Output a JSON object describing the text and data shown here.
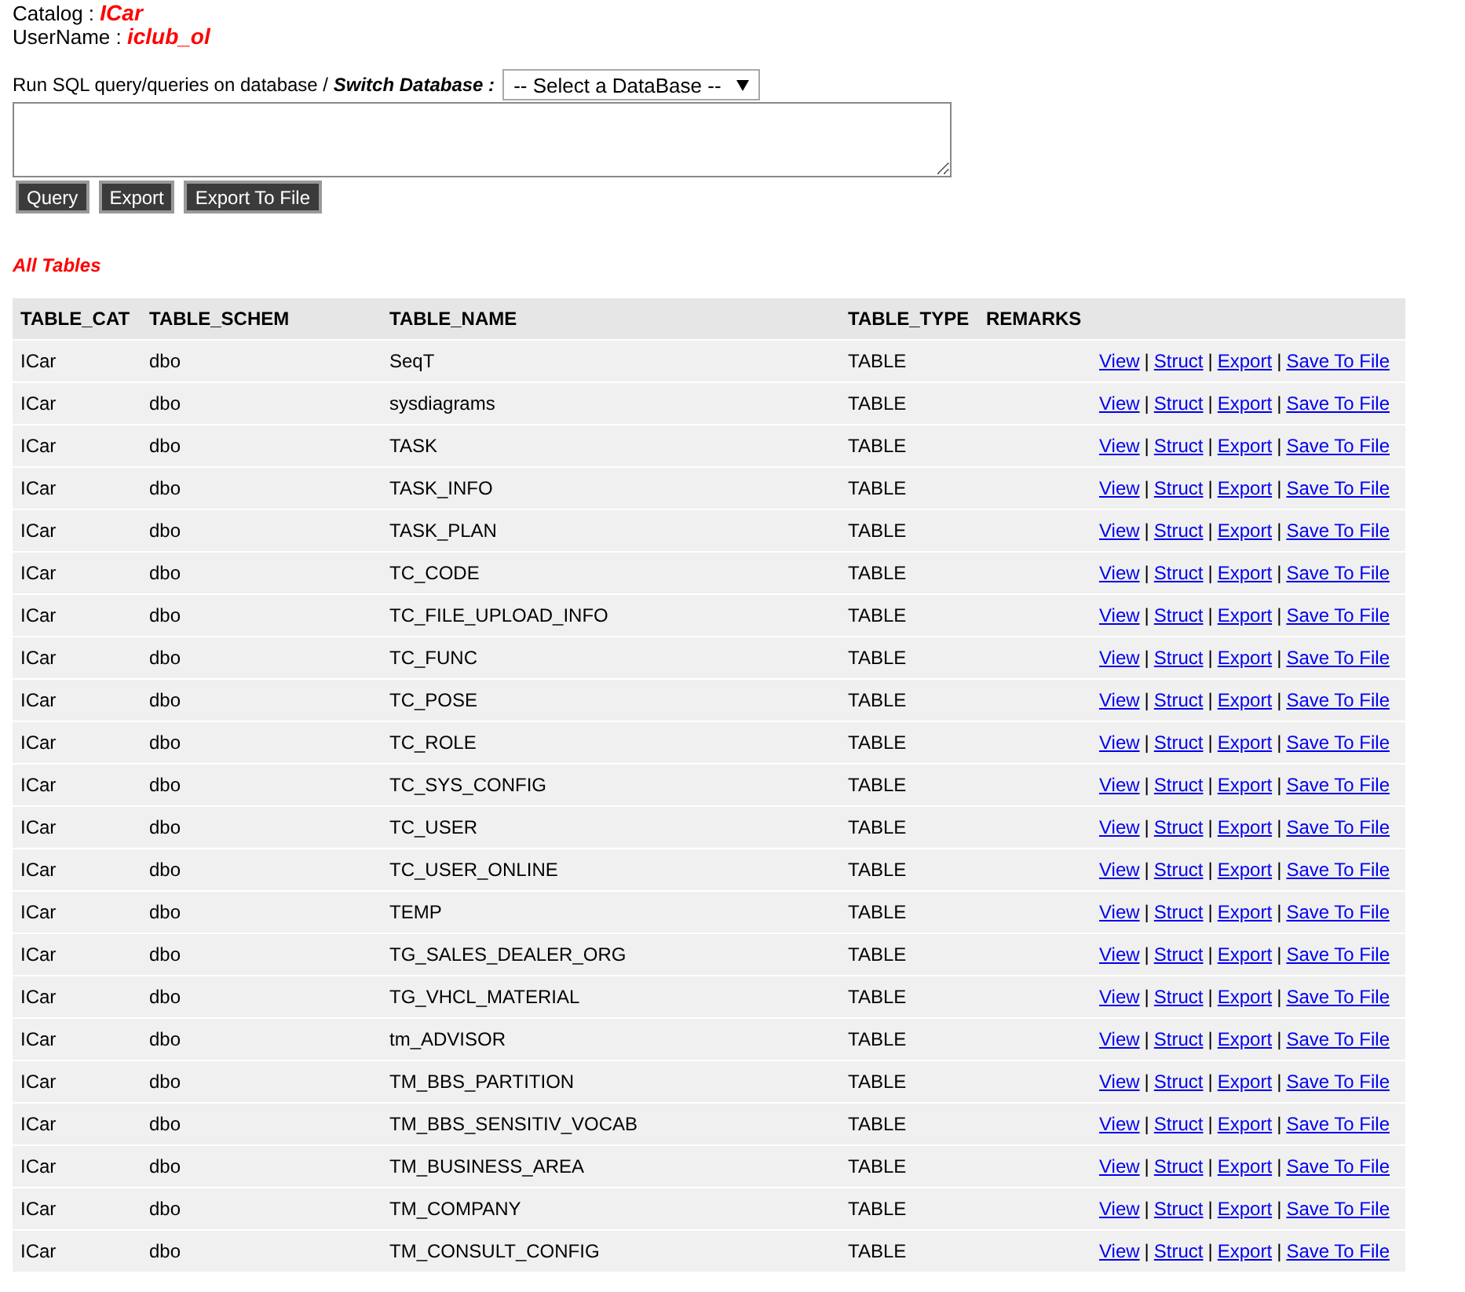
{
  "info": [
    {
      "label": "Catalog : ",
      "value": "ICar"
    },
    {
      "label": "UserName : ",
      "value": "iclub_ol"
    }
  ],
  "query": {
    "prompt": "Run SQL query/queries on database / ",
    "switch_label": "Switch Database :",
    "select": "-- Select a DataBase --",
    "buttons": [
      "Query",
      "Export",
      "Export To File"
    ]
  },
  "section_title": "All Tables",
  "table": {
    "columns": [
      "TABLE_CAT",
      "TABLE_SCHEM",
      "TABLE_NAME",
      "TABLE_TYPE",
      "REMARKS"
    ],
    "rows": [
      {
        "cells": [
          "ICar",
          "dbo",
          "SeqT",
          "TABLE"
        ],
        "actions": [
          {
            "label": "View"
          },
          {
            "separator": "|",
            "label": "Struct"
          },
          {
            "separator": "|",
            "label": "Export"
          },
          {
            "separator": "|",
            "label": "Save To File"
          }
        ]
      },
      {
        "cells": [
          "ICar",
          "dbo",
          "sysdiagrams",
          "TABLE"
        ],
        "actions": [
          {
            "label": "View"
          },
          {
            "separator": "|",
            "label": "Struct"
          },
          {
            "separator": "|",
            "label": "Export"
          },
          {
            "separator": "|",
            "label": "Save To File"
          }
        ]
      },
      {
        "cells": [
          "ICar",
          "dbo",
          "TASK",
          "TABLE"
        ],
        "actions": [
          {
            "label": "View"
          },
          {
            "separator": "|",
            "label": "Struct"
          },
          {
            "separator": "|",
            "label": "Export"
          },
          {
            "separator": "|",
            "label": "Save To File"
          }
        ]
      },
      {
        "cells": [
          "ICar",
          "dbo",
          "TASK_INFO",
          "TABLE"
        ],
        "actions": [
          {
            "label": "View"
          },
          {
            "separator": "|",
            "label": "Struct"
          },
          {
            "separator": "|",
            "label": "Export"
          },
          {
            "separator": "|",
            "label": "Save To File"
          }
        ]
      },
      {
        "cells": [
          "ICar",
          "dbo",
          "TASK_PLAN",
          "TABLE"
        ],
        "actions": [
          {
            "label": "View"
          },
          {
            "separator": "|",
            "label": "Struct"
          },
          {
            "separator": "|",
            "label": "Export"
          },
          {
            "separator": "|",
            "label": "Save To File"
          }
        ]
      },
      {
        "cells": [
          "ICar",
          "dbo",
          "TC_CODE",
          "TABLE"
        ],
        "actions": [
          {
            "label": "View"
          },
          {
            "separator": "|",
            "label": "Struct"
          },
          {
            "separator": "|",
            "label": "Export"
          },
          {
            "separator": "|",
            "label": "Save To File"
          }
        ]
      },
      {
        "cells": [
          "ICar",
          "dbo",
          "TC_FILE_UPLOAD_INFO",
          "TABLE"
        ],
        "actions": [
          {
            "label": "View"
          },
          {
            "separator": "|",
            "label": "Struct"
          },
          {
            "separator": "|",
            "label": "Export"
          },
          {
            "separator": "|",
            "label": "Save To File"
          }
        ]
      },
      {
        "cells": [
          "ICar",
          "dbo",
          "TC_FUNC",
          "TABLE"
        ],
        "actions": [
          {
            "label": "View"
          },
          {
            "separator": "|",
            "label": "Struct"
          },
          {
            "separator": "|",
            "label": "Export"
          },
          {
            "separator": "|",
            "label": "Save To File"
          }
        ]
      },
      {
        "cells": [
          "ICar",
          "dbo",
          "TC_POSE",
          "TABLE"
        ],
        "actions": [
          {
            "label": "View"
          },
          {
            "separator": "|",
            "label": "Struct"
          },
          {
            "separator": "|",
            "label": "Export"
          },
          {
            "separator": "|",
            "label": "Save To File"
          }
        ]
      },
      {
        "cells": [
          "ICar",
          "dbo",
          "TC_ROLE",
          "TABLE"
        ],
        "actions": [
          {
            "label": "View"
          },
          {
            "separator": "|",
            "label": "Struct"
          },
          {
            "separator": "|",
            "label": "Export"
          },
          {
            "separator": "|",
            "label": "Save To File"
          }
        ]
      },
      {
        "cells": [
          "ICar",
          "dbo",
          "TC_SYS_CONFIG",
          "TABLE"
        ],
        "actions": [
          {
            "label": "View"
          },
          {
            "separator": "|",
            "label": "Struct"
          },
          {
            "separator": "|",
            "label": "Export"
          },
          {
            "separator": "|",
            "label": "Save To File"
          }
        ]
      },
      {
        "cells": [
          "ICar",
          "dbo",
          "TC_USER",
          "TABLE"
        ],
        "actions": [
          {
            "label": "View"
          },
          {
            "separator": "|",
            "label": "Struct"
          },
          {
            "separator": "|",
            "label": "Export"
          },
          {
            "separator": "|",
            "label": "Save To File"
          }
        ]
      },
      {
        "cells": [
          "ICar",
          "dbo",
          "TC_USER_ONLINE",
          "TABLE"
        ],
        "actions": [
          {
            "label": "View"
          },
          {
            "separator": "|",
            "label": "Struct"
          },
          {
            "separator": "|",
            "label": "Export"
          },
          {
            "separator": "|",
            "label": "Save To File"
          }
        ]
      },
      {
        "cells": [
          "ICar",
          "dbo",
          "TEMP",
          "TABLE"
        ],
        "actions": [
          {
            "label": "View"
          },
          {
            "separator": "|",
            "label": "Struct"
          },
          {
            "separator": "|",
            "label": "Export"
          },
          {
            "separator": "|",
            "label": "Save To File"
          }
        ]
      },
      {
        "cells": [
          "ICar",
          "dbo",
          "TG_SALES_DEALER_ORG",
          "TABLE"
        ],
        "actions": [
          {
            "label": "View"
          },
          {
            "separator": "|",
            "label": "Struct"
          },
          {
            "separator": "|",
            "label": "Export"
          },
          {
            "separator": "|",
            "label": "Save To File"
          }
        ]
      },
      {
        "cells": [
          "ICar",
          "dbo",
          "TG_VHCL_MATERIAL",
          "TABLE"
        ],
        "actions": [
          {
            "label": "View"
          },
          {
            "separator": "|",
            "label": "Struct"
          },
          {
            "separator": "|",
            "label": "Export"
          },
          {
            "separator": "|",
            "label": "Save To File"
          }
        ]
      },
      {
        "cells": [
          "ICar",
          "dbo",
          "tm_ADVISOR",
          "TABLE"
        ],
        "actions": [
          {
            "label": "View"
          },
          {
            "separator": "|",
            "label": "Struct"
          },
          {
            "separator": "|",
            "label": "Export"
          },
          {
            "separator": "|",
            "label": "Save To File"
          }
        ]
      },
      {
        "cells": [
          "ICar",
          "dbo",
          "TM_BBS_PARTITION",
          "TABLE"
        ],
        "actions": [
          {
            "label": "View"
          },
          {
            "separator": "|",
            "label": "Struct"
          },
          {
            "separator": "|",
            "label": "Export"
          },
          {
            "separator": "|",
            "label": "Save To File"
          }
        ]
      },
      {
        "cells": [
          "ICar",
          "dbo",
          "TM_BBS_SENSITIV_VOCAB",
          "TABLE"
        ],
        "actions": [
          {
            "label": "View"
          },
          {
            "separator": "|",
            "label": "Struct"
          },
          {
            "separator": "|",
            "label": "Export"
          },
          {
            "separator": "|",
            "label": "Save To File"
          }
        ]
      },
      {
        "cells": [
          "ICar",
          "dbo",
          "TM_BUSINESS_AREA",
          "TABLE"
        ],
        "actions": [
          {
            "label": "View"
          },
          {
            "separator": "|",
            "label": "Struct"
          },
          {
            "separator": "|",
            "label": "Export"
          },
          {
            "separator": "|",
            "label": "Save To File"
          }
        ]
      },
      {
        "cells": [
          "ICar",
          "dbo",
          "TM_COMPANY",
          "TABLE"
        ],
        "actions": [
          {
            "label": "View"
          },
          {
            "separator": "|",
            "label": "Struct"
          },
          {
            "separator": "|",
            "label": "Export"
          },
          {
            "separator": "|",
            "label": "Save To File"
          }
        ]
      },
      {
        "cells": [
          "ICar",
          "dbo",
          "TM_CONSULT_CONFIG",
          "TABLE"
        ],
        "actions": [
          {
            "label": "View"
          },
          {
            "separator": "|",
            "label": "Struct"
          },
          {
            "separator": "|",
            "label": "Export"
          },
          {
            "separator": "|",
            "label": "Save To File"
          }
        ]
      }
    ]
  }
}
